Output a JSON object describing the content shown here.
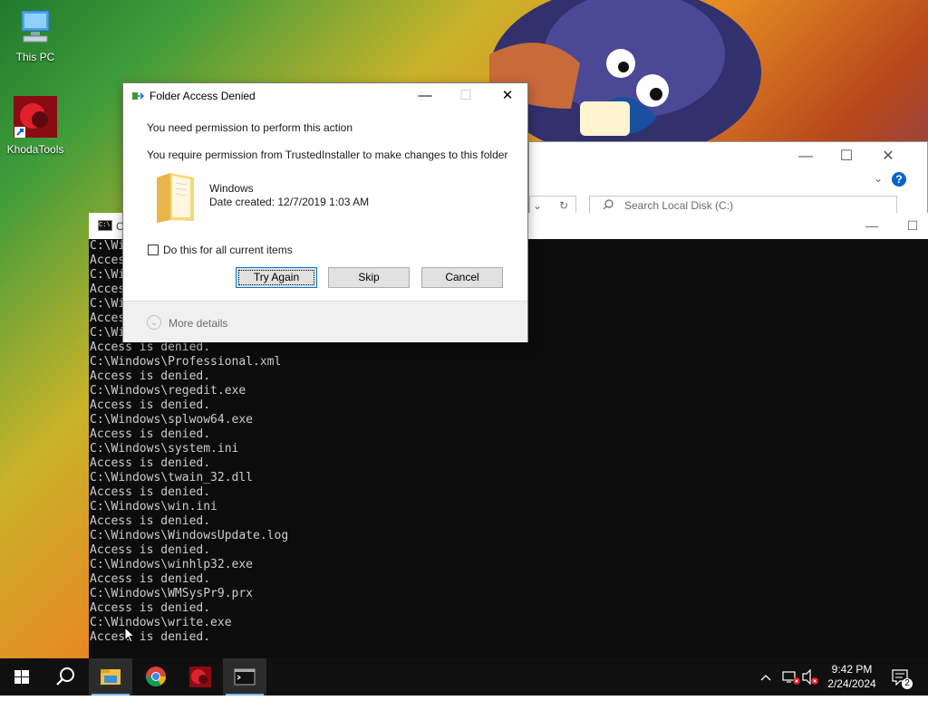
{
  "desktop": {
    "icons": [
      {
        "label": "This PC"
      },
      {
        "label": "KhodaTools"
      }
    ]
  },
  "explorer": {
    "search_placeholder": "Search Local Disk (C:)",
    "minimize": "—",
    "maximize": "☐",
    "close": "✕",
    "help": "?"
  },
  "console": {
    "title_initial": "C",
    "lines": [
      "C:\\Wi",
      "Acces",
      "C:\\Wi",
      "Acces",
      "C:\\Wi",
      "Acces",
      "C:\\Wi",
      "Access is denied.",
      "C:\\Windows\\Professional.xml",
      "Access is denied.",
      "C:\\Windows\\regedit.exe",
      "Access is denied.",
      "C:\\Windows\\splwow64.exe",
      "Access is denied.",
      "C:\\Windows\\system.ini",
      "Access is denied.",
      "C:\\Windows\\twain_32.dll",
      "Access is denied.",
      "C:\\Windows\\win.ini",
      "Access is denied.",
      "C:\\Windows\\WindowsUpdate.log",
      "Access is denied.",
      "C:\\Windows\\winhlp32.exe",
      "Access is denied.",
      "C:\\Windows\\WMSysPr9.prx",
      "Access is denied.",
      "C:\\Windows\\write.exe",
      "Access is denied."
    ]
  },
  "dialog": {
    "title": "Folder Access Denied",
    "message": "You need permission to perform this action",
    "detail": "You require permission from TrustedInstaller to make changes to this folder",
    "folder_name": "Windows",
    "folder_date": "Date created: 12/7/2019 1:03 AM",
    "checkbox_label": "Do this for all current items",
    "buttons": {
      "try_again": "Try Again",
      "skip": "Skip",
      "cancel": "Cancel"
    },
    "more_details": "More details",
    "close": "✕",
    "minimize": "—"
  },
  "taskbar": {
    "time": "9:42 PM",
    "date": "2/24/2024",
    "notification_count": "2",
    "accent": "#76b9ed"
  }
}
